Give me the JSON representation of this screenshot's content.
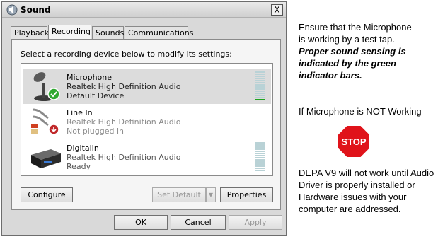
{
  "dialog": {
    "title": "Sound",
    "close_label": "X",
    "tabs": [
      {
        "label": "Playback",
        "active": false
      },
      {
        "label": "Recording",
        "active": true
      },
      {
        "label": "Sounds",
        "active": false
      },
      {
        "label": "Communications",
        "active": false
      }
    ],
    "instruction": "Select a recording device below to modify its settings:",
    "devices": [
      {
        "name": "Microphone",
        "driver": "Realtek High Definition Audio",
        "status": "Default Device",
        "selected": true,
        "icon": "microphone-icon",
        "badge": "default-check-icon",
        "level": 0.08
      },
      {
        "name": "Line In",
        "driver": "Realtek High Definition Audio",
        "status": "Not plugged in",
        "selected": false,
        "icon": "line-in-cable-icon",
        "badge": "unplugged-arrow-icon"
      },
      {
        "name": "DigitalIn",
        "driver": "Realtek High Definition Audio",
        "status": "Ready",
        "selected": false,
        "icon": "digital-in-device-icon",
        "level": 0
      }
    ],
    "buttons": {
      "configure": "Configure",
      "set_default": "Set Default",
      "properties": "Properties",
      "ok": "OK",
      "cancel": "Cancel",
      "apply": "Apply"
    }
  },
  "side_notes": {
    "line1": "Ensure that the Microphone",
    "line2": "is working by a test tap.",
    "bold1": "Proper sound sensing is",
    "bold2": "indicated by the green",
    "bold3": "indicator bars.",
    "not_working": "If Microphone is NOT Working",
    "stop_sign": "STOP",
    "warn1": "DEPA V9 will not work until Audio",
    "warn2": "Driver is properly installed or",
    "warn3": "Hardware issues with your",
    "warn4": "computer are addressed."
  },
  "colors": {
    "level_active": "#1fa21f",
    "level_idle": "#b9d2d6",
    "stop_red": "#e0131a"
  }
}
